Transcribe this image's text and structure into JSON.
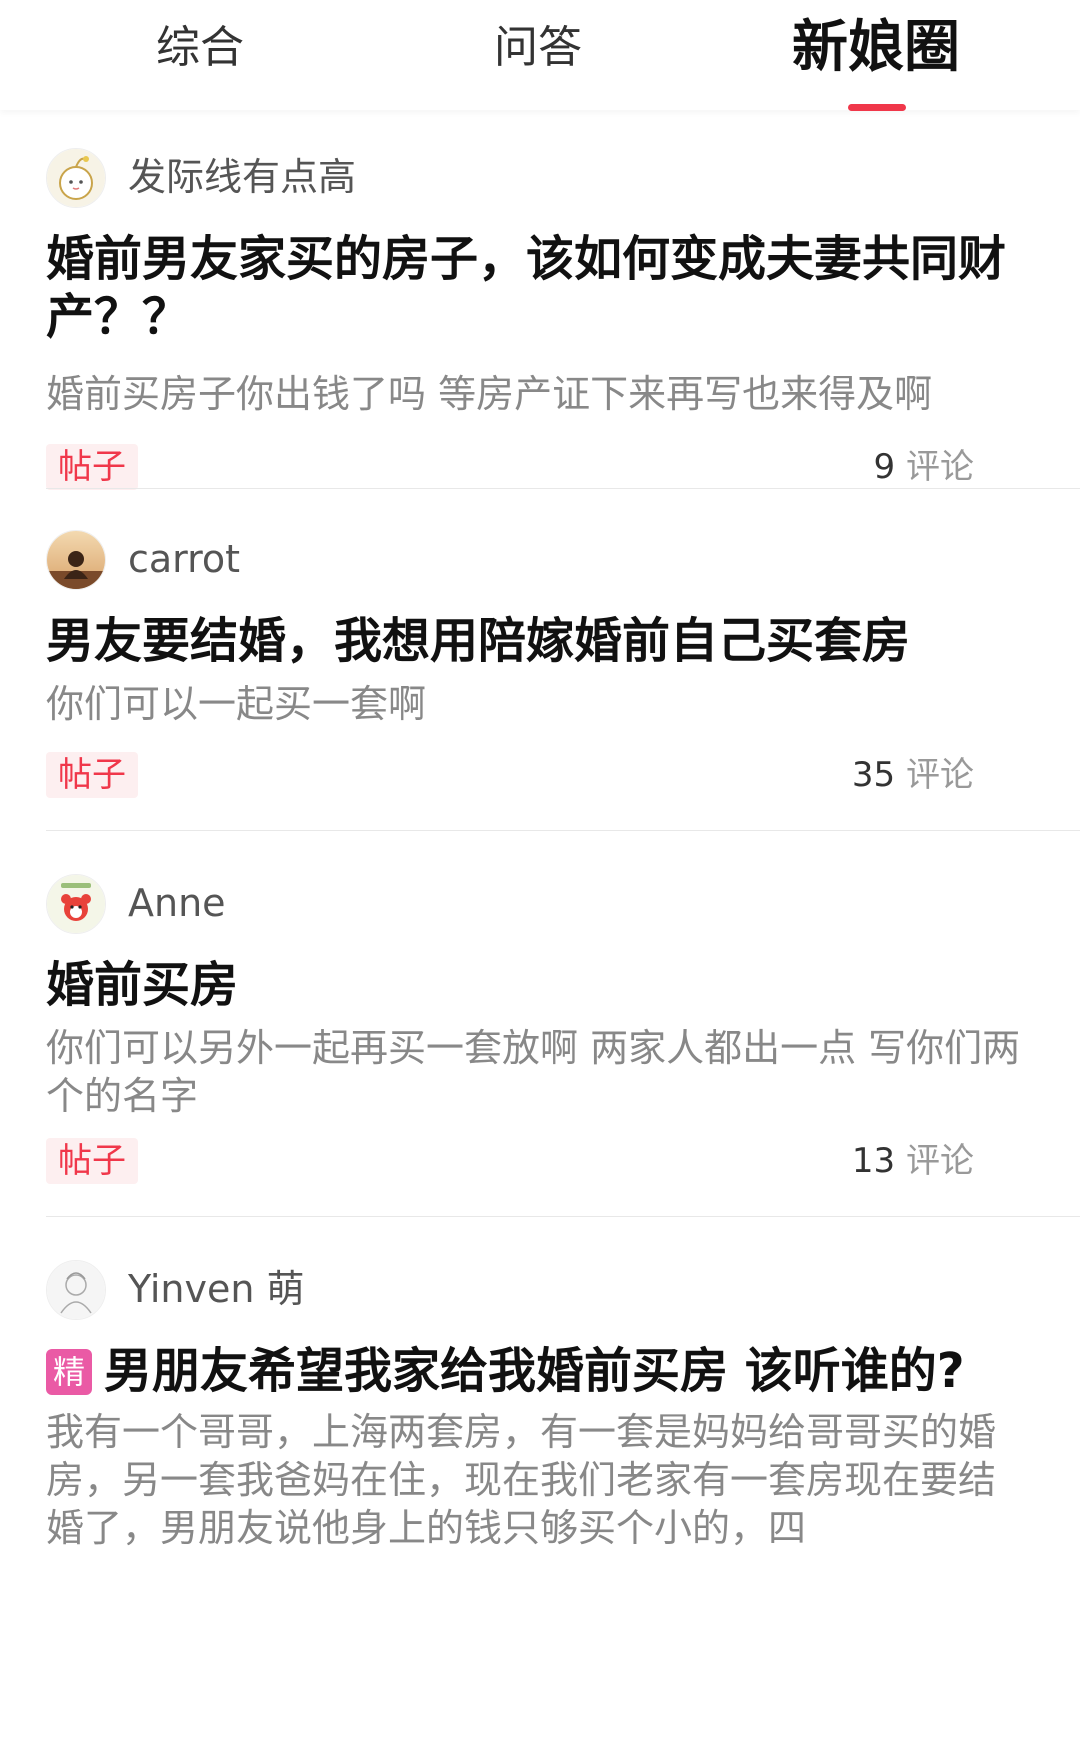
{
  "tabs": [
    {
      "label": "综合"
    },
    {
      "label": "问答"
    },
    {
      "label": "新娘圈"
    }
  ],
  "posts": [
    {
      "author": "发际线有点高",
      "title": "婚前男友家买的房子，该如何变成夫妻共同财产？？",
      "excerpt": "婚前买房子你出钱了吗 等房产证下来再写也来得及啊",
      "tag": "帖子",
      "comment_count": "9",
      "comment_label": "评论",
      "avatar_icon": "cartoon-avatar-icon"
    },
    {
      "author": "carrot",
      "title": "男友要结婚，我想用陪嫁婚前自己买套房",
      "excerpt": "你们可以一起买一套啊",
      "tag": "帖子",
      "comment_count": "35",
      "comment_label": "评论",
      "avatar_icon": "photo-avatar-icon"
    },
    {
      "author": "Anne",
      "title": "婚前买房",
      "excerpt": "你们可以另外一起再买一套放啊 两家人都出一点 写你们两个的名字",
      "tag": "帖子",
      "comment_count": "13",
      "comment_label": "评论",
      "avatar_icon": "bear-avatar-icon"
    },
    {
      "author": "Yinven 萌",
      "badge": "精",
      "title": "男朋友希望我家给我婚前买房 该听谁的?",
      "excerpt": "我有一个哥哥，上海两套房，有一套是妈妈给哥哥买的婚房，另一套我爸妈在住，现在我们老家有一套房现在要结婚了，男朋友说他身上的钱只够买个小的，四",
      "avatar_icon": "sketch-avatar-icon"
    }
  ],
  "colors": {
    "accent": "#f0374a",
    "tag_bg": "#fdeff0",
    "featured_badge": "#ea5aa5"
  }
}
